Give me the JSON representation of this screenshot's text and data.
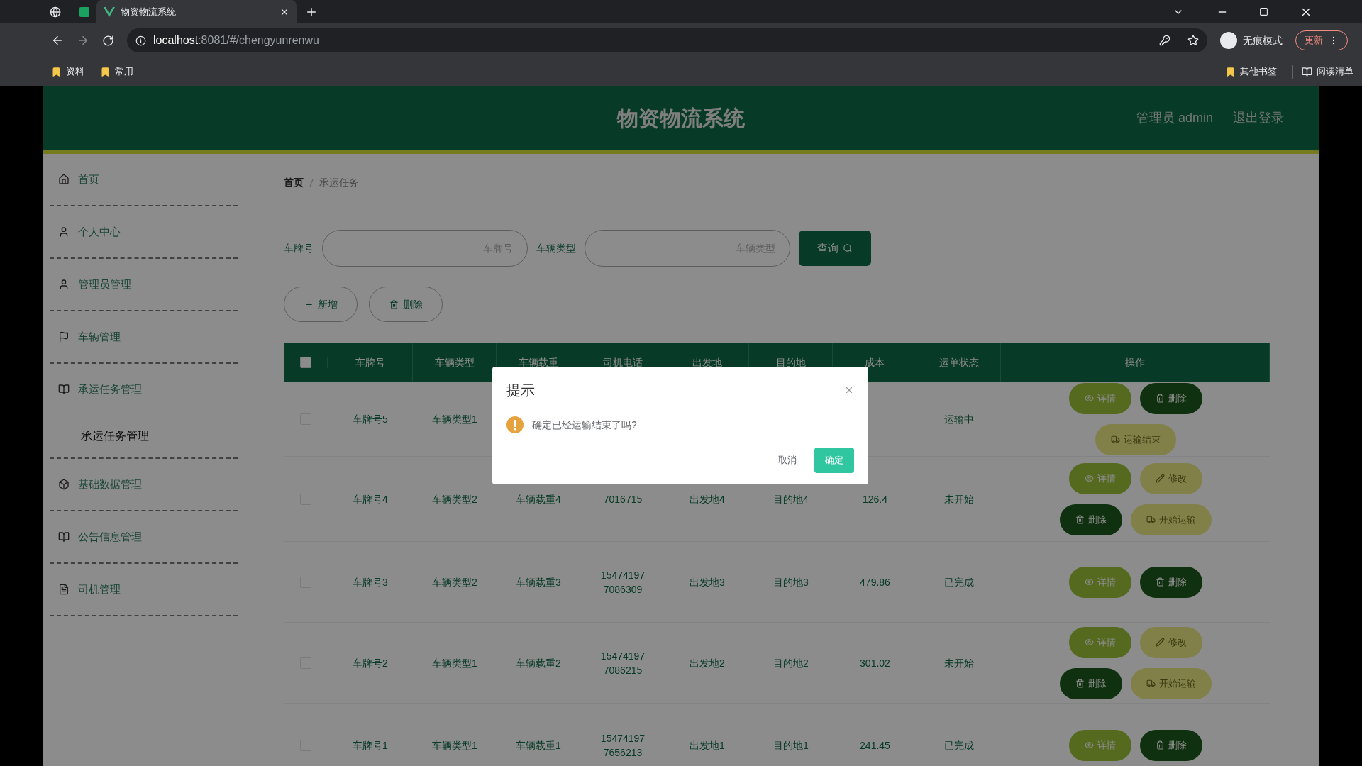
{
  "browser": {
    "tab_title": "物资物流系统",
    "url_host": "localhost",
    "url_rest": ":8081/#/chengyunrenwu",
    "incognito_label": "无痕模式",
    "update_label": "更新",
    "bookmarks": [
      "资料",
      "常用"
    ],
    "other_bookmarks": "其他书签",
    "reading_list": "阅读清单"
  },
  "header": {
    "title": "物资物流系统",
    "user": "管理员 admin",
    "logout": "退出登录"
  },
  "sidebar": {
    "items": [
      {
        "label": "首页",
        "selected": false
      },
      {
        "label": "个人中心",
        "selected": false
      },
      {
        "label": "管理员管理",
        "selected": false
      },
      {
        "label": "车辆管理",
        "selected": false
      },
      {
        "label": "承运任务管理",
        "selected": false,
        "expanded": true,
        "children": [
          {
            "label": "承运任务管理",
            "selected": true
          }
        ]
      },
      {
        "label": "基础数据管理",
        "selected": false
      },
      {
        "label": "公告信息管理",
        "selected": false
      },
      {
        "label": "司机管理",
        "selected": false
      }
    ]
  },
  "breadcrumb": [
    "首页",
    "承运任务"
  ],
  "search": {
    "fields": [
      {
        "label": "车牌号",
        "placeholder": "车牌号"
      },
      {
        "label": "车辆类型",
        "placeholder": "车辆类型"
      }
    ],
    "button": "查询"
  },
  "toolbar": [
    {
      "kind": "add",
      "label": "新增"
    },
    {
      "kind": "delete",
      "label": "删除"
    }
  ],
  "table": {
    "all_checked": false,
    "columns": [
      "车牌号",
      "车辆类型",
      "车辆载重",
      "司机电话",
      "出发地",
      "目的地",
      "成本",
      "运单状态",
      "操作"
    ],
    "rows": [
      {
        "checked": false,
        "cells": [
          "车牌号5",
          "车辆类型1",
          null,
          null,
          null,
          null,
          null,
          "运输中"
        ],
        "actions": [
          {
            "kind": "detail",
            "label": "详情"
          },
          {
            "kind": "delete",
            "label": "删除"
          },
          {
            "kind": "finish",
            "label": "运输结束"
          }
        ]
      },
      {
        "checked": false,
        "cells": [
          "车牌号4",
          "车辆类型2",
          "车辆载重4",
          "7016715",
          "出发地4",
          "目的地4",
          "126.4",
          "未开始"
        ],
        "actions": [
          {
            "kind": "detail",
            "label": "详情"
          },
          {
            "kind": "edit",
            "label": "修改"
          },
          {
            "kind": "delete",
            "label": "删除"
          },
          {
            "kind": "start",
            "label": "开始运输"
          }
        ]
      },
      {
        "checked": false,
        "cells": [
          "车牌号3",
          "车辆类型2",
          "车辆载重3",
          "154741977086309",
          "出发地3",
          "目的地3",
          "479.86",
          "已完成"
        ],
        "actions": [
          {
            "kind": "detail",
            "label": "详情"
          },
          {
            "kind": "delete",
            "label": "删除"
          }
        ]
      },
      {
        "checked": false,
        "cells": [
          "车牌号2",
          "车辆类型1",
          "车辆载重2",
          "154741977086215",
          "出发地2",
          "目的地2",
          "301.02",
          "未开始"
        ],
        "actions": [
          {
            "kind": "detail",
            "label": "详情"
          },
          {
            "kind": "edit",
            "label": "修改"
          },
          {
            "kind": "delete",
            "label": "删除"
          },
          {
            "kind": "start",
            "label": "开始运输"
          }
        ]
      },
      {
        "checked": false,
        "cells": [
          "车牌号1",
          "车辆类型1",
          "车辆载重1",
          "154741977656213",
          "出发地1",
          "目的地1",
          "241.45",
          "已完成"
        ],
        "actions": [
          {
            "kind": "detail",
            "label": "详情"
          },
          {
            "kind": "delete",
            "label": "删除"
          }
        ]
      }
    ]
  },
  "dialog": {
    "title": "提示",
    "message": "确定已经运输结束了吗?",
    "cancel": "取消",
    "confirm": "确定"
  }
}
